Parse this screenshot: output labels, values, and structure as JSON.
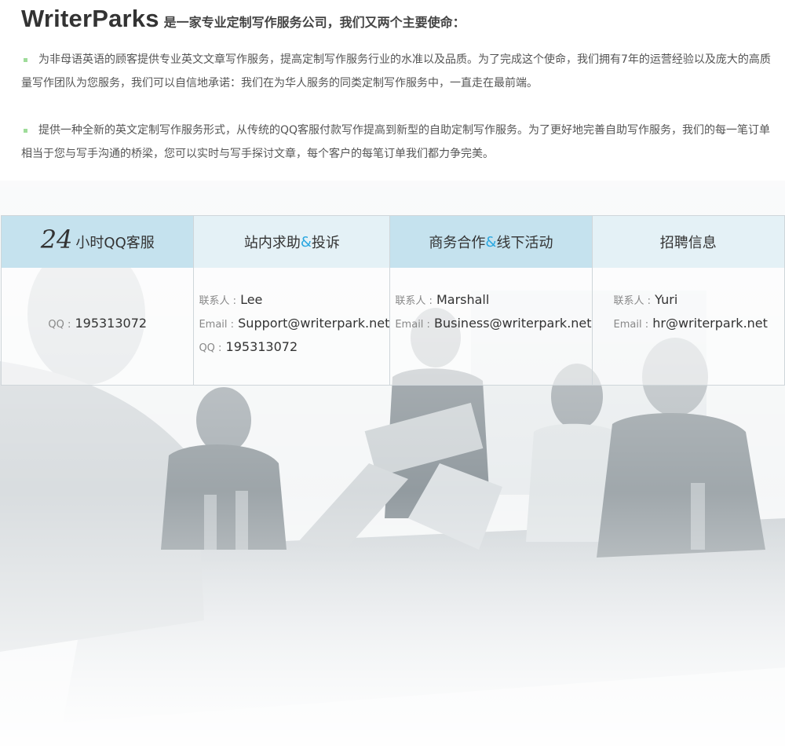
{
  "intro": {
    "brand": "WriterParks",
    "tagline": "是一家专业定制写作服务公司，我们又两个主要使命：",
    "missions": [
      "为非母语英语的顾客提供专业英文文章写作服务，提高定制写作服务行业的水准以及品质。为了完成这个使命，我们拥有7年的运营经验以及庞大的高质量写作团队为您服务，我们可以自信地承诺：我们在为华人服务的同类定制写作服务中，一直走在最前端。",
      "提供一种全新的英文定制写作服务形式，从传统的QQ客服付款写作提高到新型的自助定制写作服务。为了更好地完善自助写作服务，我们的每一笔订单相当于您与写手沟通的桥梁，您可以实时与写手探讨文章，每个客户的每笔订单我们都力争完美。"
    ],
    "bullet_color": "#9fdc9a"
  },
  "contacts": {
    "columns": [
      {
        "hours_number": "24",
        "title": "小时QQ客服",
        "qq_label": "QQ :",
        "qq": "195313072"
      },
      {
        "title_pre": "站内求助",
        "title_amp": "&",
        "title_post": "投诉",
        "contact_label": "联系人 :",
        "contact": "Lee",
        "email_label": "Email :",
        "email": "Support@writerpark.net",
        "qq_label": "QQ :",
        "qq": "195313072"
      },
      {
        "title_pre": "商务合作",
        "title_amp": "&",
        "title_post": "线下活动",
        "contact_label": "联系人 :",
        "contact": "Marshall",
        "email_label": "Email :",
        "email": "Business@writerpark.net"
      },
      {
        "title": "招聘信息",
        "contact_label": "联系人 :",
        "contact": "Yuri",
        "email_label": "Email :",
        "email": "hr@writerpark.net"
      }
    ],
    "header_colors": [
      "#c5e2ee",
      "#e4f1f6"
    ],
    "accent_color": "#2aa7e0"
  },
  "background": {
    "icon": "office-meeting-photo"
  }
}
